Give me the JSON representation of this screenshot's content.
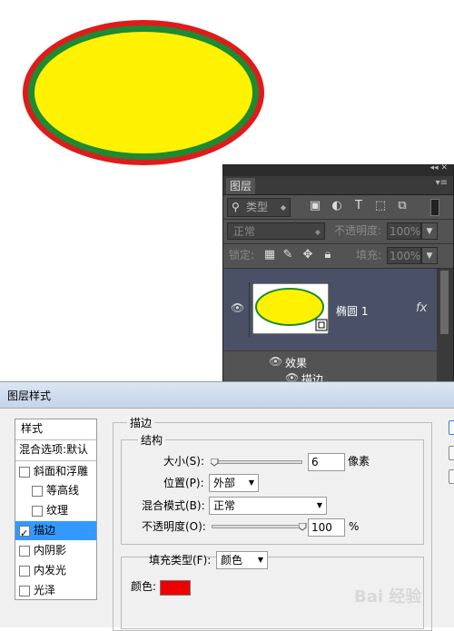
{
  "canvas": {
    "shape": "ellipse",
    "fill_color": "#fff200",
    "inner_stroke_color": "#1e8a32",
    "outer_stroke_color": "#e01b1b"
  },
  "layers_panel": {
    "top_icons": "◂◂  ✕",
    "tab_label": "图层",
    "menu_icon": "▾≡",
    "filter_kind": "类型",
    "blend_mode": "正常",
    "opacity_label": "不透明度:",
    "opacity_value": "100%",
    "lock_label": "锁定:",
    "fill_label": "填充:",
    "fill_value": "100%",
    "layer_name": "椭圆 1",
    "fx_label": "fx",
    "effects_label": "效果",
    "stroke_effect_label": "描边"
  },
  "dialog": {
    "title": "图层样式",
    "left_list": {
      "styles_header": "样式",
      "blend_options": "混合选项:默认",
      "items": [
        {
          "label": "斜面和浮雕",
          "checked": false
        },
        {
          "label": "等高线",
          "checked": false
        },
        {
          "label": "纹理",
          "checked": false
        },
        {
          "label": "描边",
          "checked": true
        },
        {
          "label": "内阴影",
          "checked": false
        },
        {
          "label": "内发光",
          "checked": false
        },
        {
          "label": "光泽",
          "checked": false
        }
      ]
    },
    "stroke": {
      "section_title": "描边",
      "structure_title": "结构",
      "size_label": "大小(S):",
      "size_value": "6",
      "size_unit": "像素",
      "size_fraction": 0.03,
      "position_label": "位置(P):",
      "position_value": "外部",
      "blend_mode_label": "混合模式(B):",
      "blend_mode_value": "正常",
      "opacity_label": "不透明度(O):",
      "opacity_value": "100",
      "opacity_unit": "%",
      "opacity_fraction": 1.0,
      "fill_type_label": "填充类型(F):",
      "fill_type_value": "颜色",
      "color_label": "颜色:",
      "color_value": "#ee0000"
    }
  },
  "watermark": "Bai 经验"
}
